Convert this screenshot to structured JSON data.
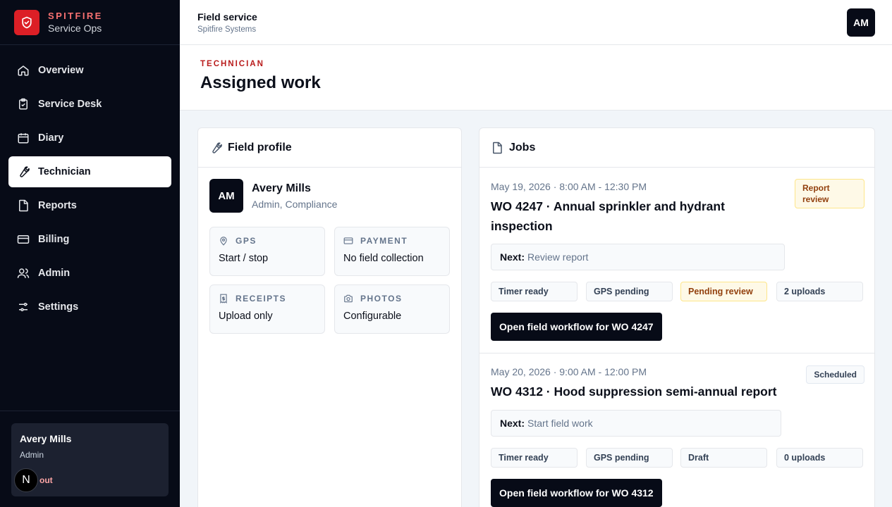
{
  "brand": {
    "name": "SPITFIRE",
    "subtitle": "Service Ops",
    "accent": "#dc1f26"
  },
  "nav": [
    {
      "label": "Overview",
      "icon": "home-icon"
    },
    {
      "label": "Service Desk",
      "icon": "clipboard-icon"
    },
    {
      "label": "Diary",
      "icon": "calendar-icon"
    },
    {
      "label": "Technician",
      "icon": "wrench-icon",
      "active": true
    },
    {
      "label": "Reports",
      "icon": "document-icon"
    },
    {
      "label": "Billing",
      "icon": "credit-card-icon"
    },
    {
      "label": "Admin",
      "icon": "users-icon"
    },
    {
      "label": "Settings",
      "icon": "sliders-icon"
    }
  ],
  "sidebar_user": {
    "name": "Avery Mills",
    "role": "Admin",
    "signout": "out",
    "badge": "N"
  },
  "topbar": {
    "title": "Field service",
    "subtitle": "Spitfire Systems",
    "avatar": "AM"
  },
  "page": {
    "eyebrow": "TECHNICIAN",
    "title": "Assigned work"
  },
  "profile": {
    "heading": "Field profile",
    "initials": "AM",
    "name": "Avery Mills",
    "role": "Admin, Compliance",
    "tiles": [
      {
        "label": "GPS",
        "value": "Start / stop",
        "icon": "map-pin-icon"
      },
      {
        "label": "PAYMENT",
        "value": "No field collection",
        "icon": "credit-card-icon"
      },
      {
        "label": "RECEIPTS",
        "value": "Upload only",
        "icon": "receipt-icon"
      },
      {
        "label": "PHOTOS",
        "value": "Configurable",
        "icon": "camera-icon"
      }
    ]
  },
  "jobs": {
    "heading": "Jobs",
    "items": [
      {
        "date": "May 19, 2026 · 8:00 AM - 12:30 PM",
        "title_line1": "WO 4247 · Annual sprinkler and hydrant",
        "title_line2": "inspection",
        "status": "Report review",
        "next_label": "Next:",
        "next_value": "Review report",
        "pills": [
          "Timer ready",
          "GPS pending",
          "Pending review",
          "2 uploads"
        ],
        "button": "Open field workflow for WO 4247"
      },
      {
        "date": "May 20, 2026 · 9:00 AM - 12:00 PM",
        "title_line1": "WO 4312 · Hood suppression semi-annual report",
        "status": "Scheduled",
        "next_label": "Next:",
        "next_value": "Start field work",
        "pills": [
          "Timer ready",
          "GPS pending",
          "Draft",
          "0 uploads"
        ],
        "button": "Open field workflow for WO 4312"
      }
    ]
  }
}
